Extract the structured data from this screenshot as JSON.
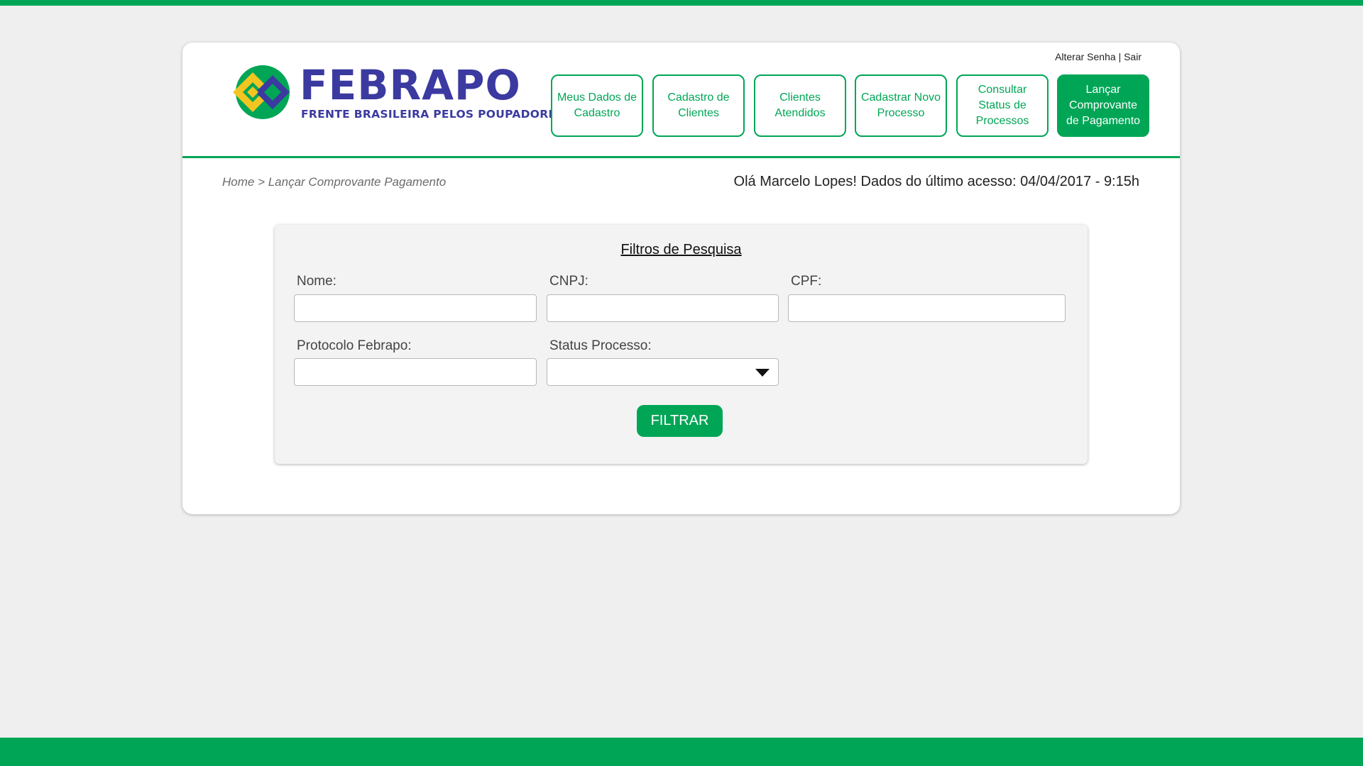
{
  "colors": {
    "brand_green": "#00a656",
    "brand_blue": "#3b3aa0",
    "brand_yellow": "#f2c521"
  },
  "logo": {
    "title": "FEBRAPO",
    "subtitle": "FRENTE BRASILEIRA PELOS POUPADORES"
  },
  "account": {
    "change_password": "Alterar Senha",
    "separator": "|",
    "logout": "Sair"
  },
  "nav": {
    "items": [
      {
        "label": "Meus Dados de Cadastro",
        "active": false
      },
      {
        "label": "Cadastro de Clientes",
        "active": false
      },
      {
        "label": "Clientes Atendidos",
        "active": false
      },
      {
        "label": "Cadastrar Novo Processo",
        "active": false
      },
      {
        "label": "Consultar Status de Processos",
        "active": false
      },
      {
        "label": "Lançar Comprovante de Pagamento",
        "active": true
      }
    ]
  },
  "breadcrumb": {
    "text": "Home > Lançar Comprovante Pagamento"
  },
  "greeting": {
    "text": "Olá Marcelo Lopes! Dados do último acesso: 04/04/2017 - 9:15h"
  },
  "filters": {
    "title": "Filtros de Pesquisa",
    "nome": {
      "label": "Nome:",
      "value": ""
    },
    "cnpj": {
      "label": "CNPJ:",
      "value": ""
    },
    "cpf": {
      "label": "CPF:",
      "value": ""
    },
    "protocolo": {
      "label": "Protocolo Febrapo:",
      "value": ""
    },
    "status": {
      "label": "Status Processo:",
      "selected": ""
    },
    "button": "FILTRAR"
  }
}
